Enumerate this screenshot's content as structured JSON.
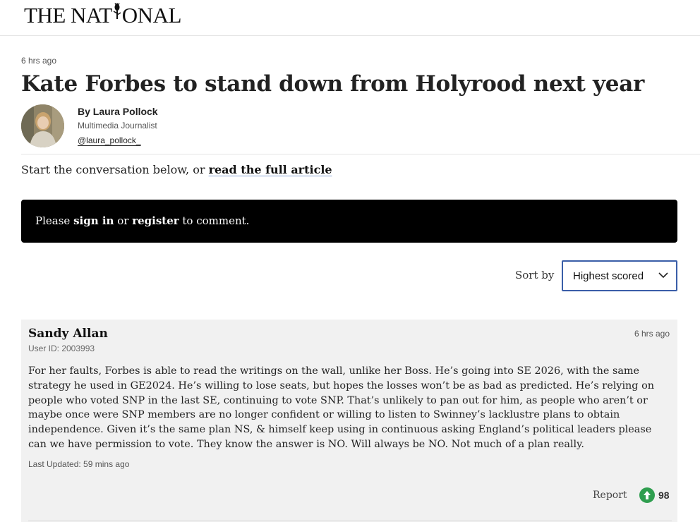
{
  "masthead": {
    "logo_left": "THE NAT",
    "logo_right": "ONAL",
    "logo_mark": "thistle-icon"
  },
  "article": {
    "timestamp": "6 hrs ago",
    "headline": "Kate Forbes to stand down from Holyrood next year",
    "author_name": "By Laura Pollock",
    "author_role": "Multimedia Journalist",
    "author_handle": "@laura_pollock_"
  },
  "conversation": {
    "intro_text": "Start the conversation below, or ",
    "intro_link": "read the full article"
  },
  "signin": {
    "prefix": "Please ",
    "sign_in": "sign in",
    "middle": " or ",
    "register": "register",
    "suffix": " to comment."
  },
  "sort": {
    "label": "Sort by",
    "selected": "Highest scored"
  },
  "comments": [
    {
      "author": "Sandy Allan",
      "user_id": "User ID: 2003993",
      "time": "6 hrs ago",
      "body": "For her faults, Forbes is able to read the writings on the wall, unlike her Boss. He’s going into SE 2026, with the same strategy he used in GE2024. He’s willing to lose seats, but hopes the losses won’t be as bad as predicted. He’s relying on people who voted SNP in the last SE, continuing to vote SNP. That’s unlikely to pan out for him, as people who aren’t or maybe once were SNP members are no longer confident or willing to listen to Swinney’s lacklustre plans to obtain independence. Given it’s the same plan NS, & himself keep using in continuous asking England’s political leaders please can we have permission to vote. They know the answer is NO. Will always be NO. Not much of a plan really.",
      "last_updated": "Last Updated: 59 mins ago",
      "report_label": "Report",
      "score": "98"
    }
  ],
  "colors": {
    "accent_blue": "#3a5ea8",
    "vote_green": "#2f9e4f",
    "signin_bg": "#000000",
    "comment_bg": "#f1f1f1"
  }
}
